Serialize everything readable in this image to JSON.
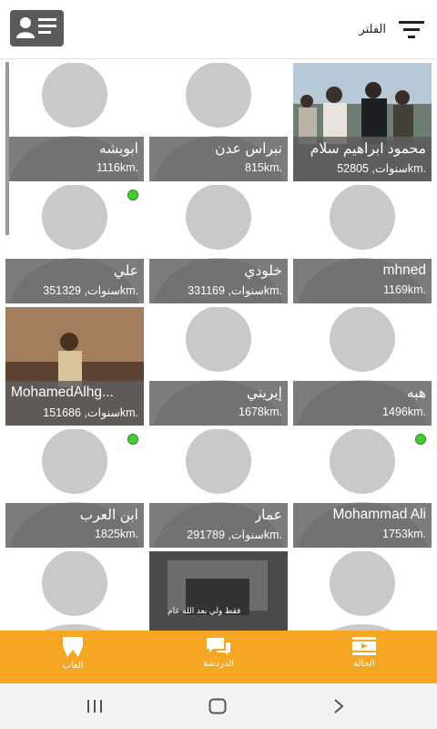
{
  "header": {
    "filter_label": "الفلتر"
  },
  "profiles": [
    {
      "name": "محمود ابراهيم سلام",
      "dist": "52سنوات, 805km.",
      "online": false,
      "photo": true
    },
    {
      "name": "نبراس عدن",
      "dist": "815km.",
      "online": false,
      "photo": false
    },
    {
      "name": "ابويشه",
      "dist": "1116km.",
      "online": false,
      "photo": false
    },
    {
      "name": "mhned",
      "dist": "1169km.",
      "online": false,
      "photo": false
    },
    {
      "name": "خلودي",
      "dist": "33سنوات, 1169km.",
      "online": false,
      "photo": false
    },
    {
      "name": "علي",
      "dist": "35سنوات, 1329km.",
      "online": true,
      "photo": false
    },
    {
      "name": "هبه",
      "dist": "1496km.",
      "online": false,
      "photo": false
    },
    {
      "name": "إيريني",
      "dist": "1678km.",
      "online": false,
      "photo": false
    },
    {
      "name": "MohamedAlhg...",
      "dist": "15سنوات, 1686km.",
      "online": false,
      "photo": true
    },
    {
      "name": "Mohammad Ali",
      "dist": "1753km.",
      "online": true,
      "photo": false
    },
    {
      "name": "عمار",
      "dist": "29سنوات, 1789km.",
      "online": false,
      "photo": false
    },
    {
      "name": "ابن العرب",
      "dist": "1825km.",
      "online": true,
      "photo": false
    },
    {
      "name": "",
      "dist": "",
      "online": false,
      "photo": false
    },
    {
      "name": "",
      "dist": "",
      "online": false,
      "photo": true,
      "overlay_text": "فقط ولي بعد الله عام"
    },
    {
      "name": "",
      "dist": "",
      "online": false,
      "photo": false
    }
  ],
  "nav": {
    "status_label": "الحالة",
    "chat_label": "الدردشة",
    "games_label": "العاب"
  },
  "colors": {
    "accent": "#f5a623",
    "online": "#42d02e",
    "caption_bg": "#5f5f5f",
    "avatar": "#c9c9c9"
  }
}
